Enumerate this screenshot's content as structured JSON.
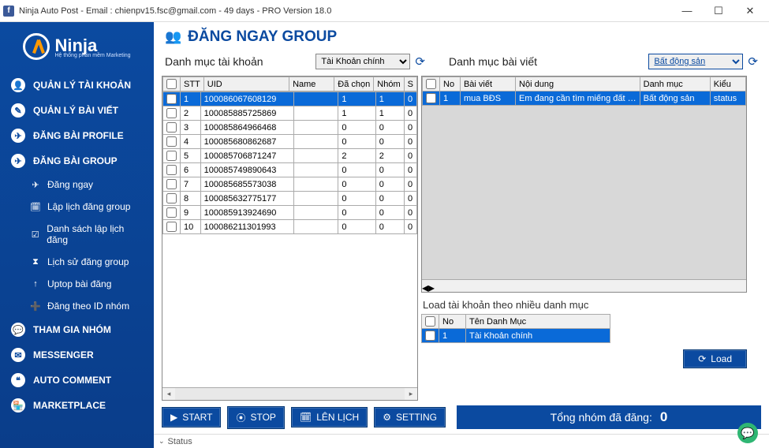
{
  "window": {
    "title": "Ninja Auto Post - Email : chienpv15.fsc@gmail.com - 49 days -  PRO Version 18.0"
  },
  "brand": {
    "name": "Ninja",
    "tagline": "Hệ thống phần mềm Marketing"
  },
  "sidebar": {
    "items": [
      {
        "label": "QUẢN LÝ TÀI KHOẢN",
        "icon": "👤"
      },
      {
        "label": "QUẢN LÝ BÀI VIẾT",
        "icon": "✎"
      },
      {
        "label": "ĐĂNG BÀI PROFILE",
        "icon": "✈"
      },
      {
        "label": "ĐĂNG BÀI GROUP",
        "icon": "✈"
      }
    ],
    "subs": [
      {
        "label": "Đăng ngay",
        "icon": "✈"
      },
      {
        "label": "Lập lịch đăng group",
        "icon": "🗓"
      },
      {
        "label": "Danh sách lập lịch đăng",
        "icon": "☑"
      },
      {
        "label": "Lịch sử đăng group",
        "icon": "⧗"
      },
      {
        "label": "Uptop bài đăng",
        "icon": "↑"
      },
      {
        "label": "Đăng theo ID nhóm",
        "icon": "➕"
      }
    ],
    "items2": [
      {
        "label": "THAM GIA NHÓM",
        "icon": "💬"
      },
      {
        "label": "MESSENGER",
        "icon": "✉"
      },
      {
        "label": "AUTO COMMENT",
        "icon": "❝"
      },
      {
        "label": "MARKETPLACE",
        "icon": "🏪"
      }
    ]
  },
  "page": {
    "title": "ĐĂNG NGAY GROUP",
    "account_cat_label": "Danh mục tài khoản",
    "account_cat_value": "Tài Khoản chính",
    "post_cat_label": "Danh mục bài viết",
    "post_cat_value": "Bất động sản"
  },
  "accounts": {
    "headers": {
      "chk": "",
      "stt": "STT",
      "uid": "UID",
      "name": "Name",
      "dachon": "Đã chọn",
      "nhom": "Nhóm",
      "s": "S"
    },
    "rows": [
      {
        "stt": "1",
        "uid": "100086067608129",
        "name": "",
        "dachon": "1",
        "nhom": "1",
        "s": "0",
        "selected": true
      },
      {
        "stt": "2",
        "uid": "100085885725869",
        "name": "",
        "dachon": "1",
        "nhom": "1",
        "s": "0"
      },
      {
        "stt": "3",
        "uid": "100085864966468",
        "name": "",
        "dachon": "0",
        "nhom": "0",
        "s": "0"
      },
      {
        "stt": "4",
        "uid": "100085680862687",
        "name": "",
        "dachon": "0",
        "nhom": "0",
        "s": "0"
      },
      {
        "stt": "5",
        "uid": "100085706871247",
        "name": "",
        "dachon": "2",
        "nhom": "2",
        "s": "0"
      },
      {
        "stt": "6",
        "uid": "100085749890643",
        "name": "",
        "dachon": "0",
        "nhom": "0",
        "s": "0"
      },
      {
        "stt": "7",
        "uid": "100085685573038",
        "name": "",
        "dachon": "0",
        "nhom": "0",
        "s": "0"
      },
      {
        "stt": "8",
        "uid": "100085632775177",
        "name": "",
        "dachon": "0",
        "nhom": "0",
        "s": "0"
      },
      {
        "stt": "9",
        "uid": "100085913924690",
        "name": "",
        "dachon": "0",
        "nhom": "0",
        "s": "0"
      },
      {
        "stt": "10",
        "uid": "100086211301993",
        "name": "",
        "dachon": "0",
        "nhom": "0",
        "s": "0"
      }
    ]
  },
  "posts": {
    "headers": {
      "no": "No",
      "baiviet": "Bài viết",
      "noidung": "Nội dung",
      "danhmuc": "Danh mục",
      "kieu": "Kiểu"
    },
    "rows": [
      {
        "no": "1",
        "baiviet": "mua BĐS",
        "noidung": "Em đang cần tìm miếng đất …",
        "danhmuc": "Bất động sản",
        "kieu": "status",
        "selected": true
      }
    ]
  },
  "multi_cat": {
    "title": "Load tài khoản theo nhiều danh mục",
    "headers": {
      "no": "No",
      "ten": "Tên Danh Mục"
    },
    "rows": [
      {
        "no": "1",
        "ten": "Tài Khoản chính",
        "selected": true
      }
    ],
    "load_label": "Load"
  },
  "actions": {
    "start": "START",
    "stop": "STOP",
    "schedule": "LÊN LỊCH",
    "setting": "SETTING",
    "total_label": "Tổng nhóm đã đăng:",
    "total_value": "0"
  },
  "status": {
    "label": "Status"
  }
}
